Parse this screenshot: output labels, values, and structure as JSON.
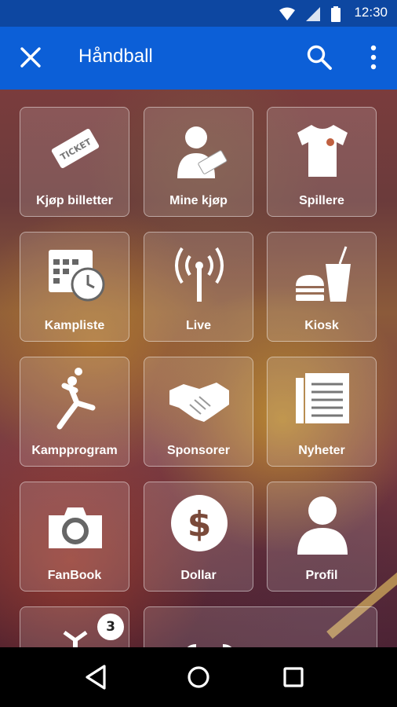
{
  "status_bar": {
    "time": "12:30",
    "icons": [
      "wifi-icon",
      "signal-icon",
      "battery-icon"
    ]
  },
  "app_bar": {
    "title": "Håndball",
    "icons": [
      "close-icon",
      "search-icon",
      "more-vert-icon"
    ]
  },
  "tiles": [
    {
      "label": "Kjøp billetter",
      "icon": "ticket-icon"
    },
    {
      "label": "Mine kjøp",
      "icon": "person-ticket-icon"
    },
    {
      "label": "Spillere",
      "icon": "jersey-icon"
    },
    {
      "label": "Kampliste",
      "icon": "calendar-clock-icon"
    },
    {
      "label": "Live",
      "icon": "antenna-icon"
    },
    {
      "label": "Kiosk",
      "icon": "burger-drink-icon"
    },
    {
      "label": "Kampprogram",
      "icon": "handball-player-icon"
    },
    {
      "label": "Sponsorer",
      "icon": "handshake-icon"
    },
    {
      "label": "Nyheter",
      "icon": "newspaper-icon"
    },
    {
      "label": "FanBook",
      "icon": "camera-icon"
    },
    {
      "label": "Dollar",
      "icon": "dollar-icon"
    },
    {
      "label": "Profil",
      "icon": "profile-icon"
    },
    {
      "label": "",
      "icon": "download-icon",
      "badge": "3"
    },
    {
      "label": "",
      "icon": "share-icon"
    }
  ],
  "nav_bar": {
    "icons": [
      "back-icon",
      "home-icon",
      "recents-icon"
    ]
  }
}
